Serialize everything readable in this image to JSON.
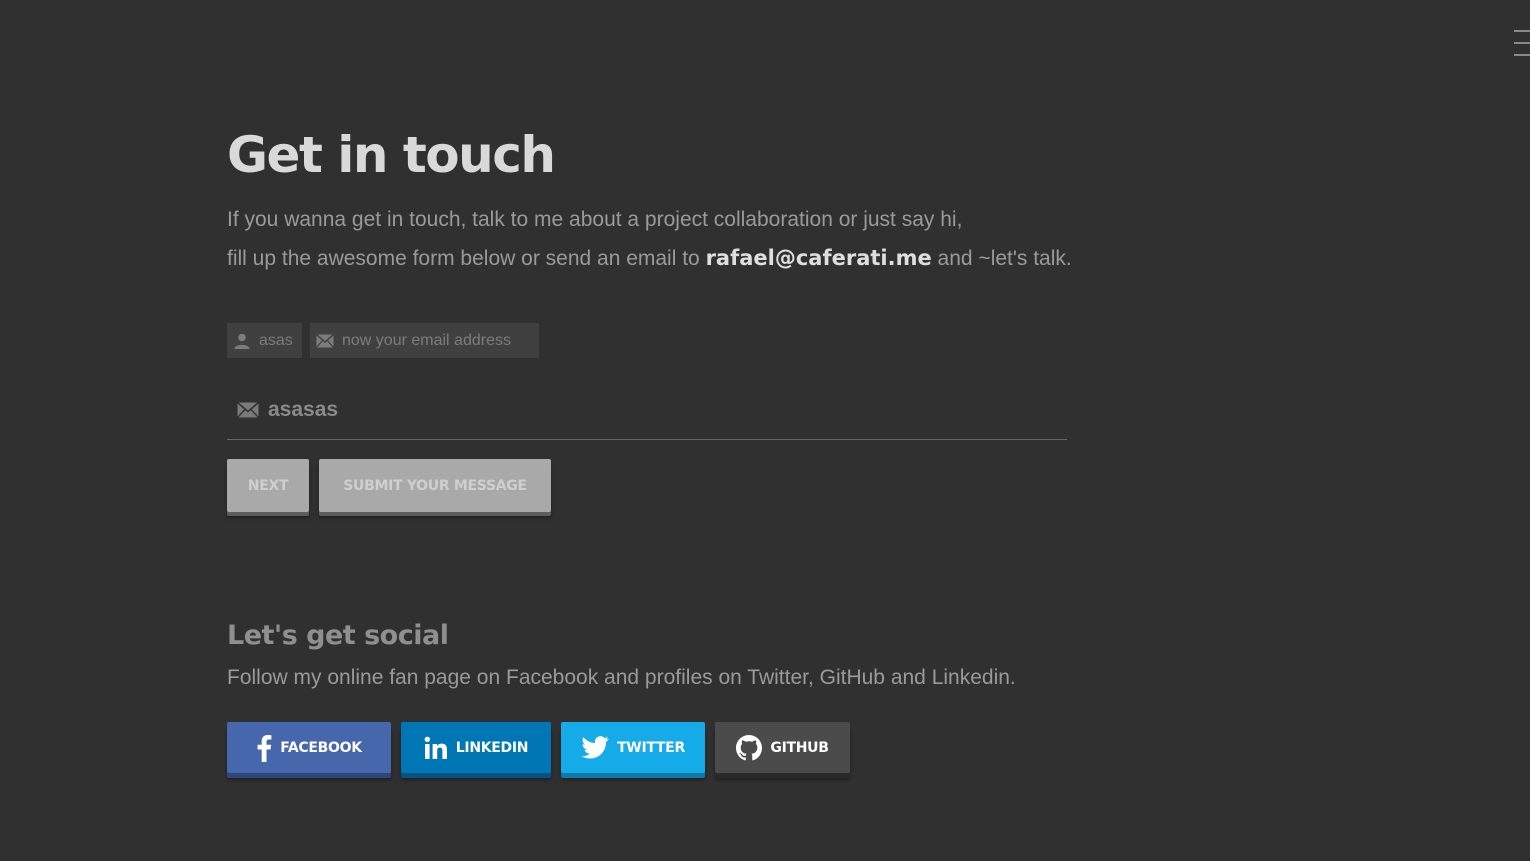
{
  "header": {
    "menu_icon": "hamburger-menu-icon"
  },
  "contact": {
    "title": "Get in touch",
    "intro_line1": "If you wanna get in touch, talk to me about a project collaboration or just say hi,",
    "intro_line2_before": "fill up the awesome form below or send an email to ",
    "email": "rafael@caferati.me",
    "intro_line2_after": " and ~let's talk."
  },
  "form": {
    "name_chip": {
      "icon": "user-icon",
      "value": "asas"
    },
    "email_chip": {
      "icon": "envelope-icon",
      "placeholder": "now your email address"
    },
    "message_field": {
      "icon": "envelope-icon",
      "value": "asasas"
    },
    "next_label": "NEXT",
    "submit_label": "SUBMIT YOUR MESSAGE"
  },
  "social": {
    "title": "Let's get social",
    "description": "Follow my online fan page on Facebook and profiles on Twitter, GitHub and Linkedin.",
    "buttons": [
      {
        "label": "FACEBOOK",
        "icon": "facebook-icon",
        "color": "#4667ac"
      },
      {
        "label": "LINKEDIN",
        "icon": "linkedin-icon",
        "color": "#0077b5"
      },
      {
        "label": "TWITTER",
        "icon": "twitter-icon",
        "color": "#15abe9"
      },
      {
        "label": "GITHUB",
        "icon": "github-icon",
        "color": "#4b4b4b"
      }
    ]
  },
  "colors": {
    "background": "#303030",
    "title": "#d9d9d9",
    "text": "#9a9a9a",
    "button": "#a9a9a9"
  }
}
